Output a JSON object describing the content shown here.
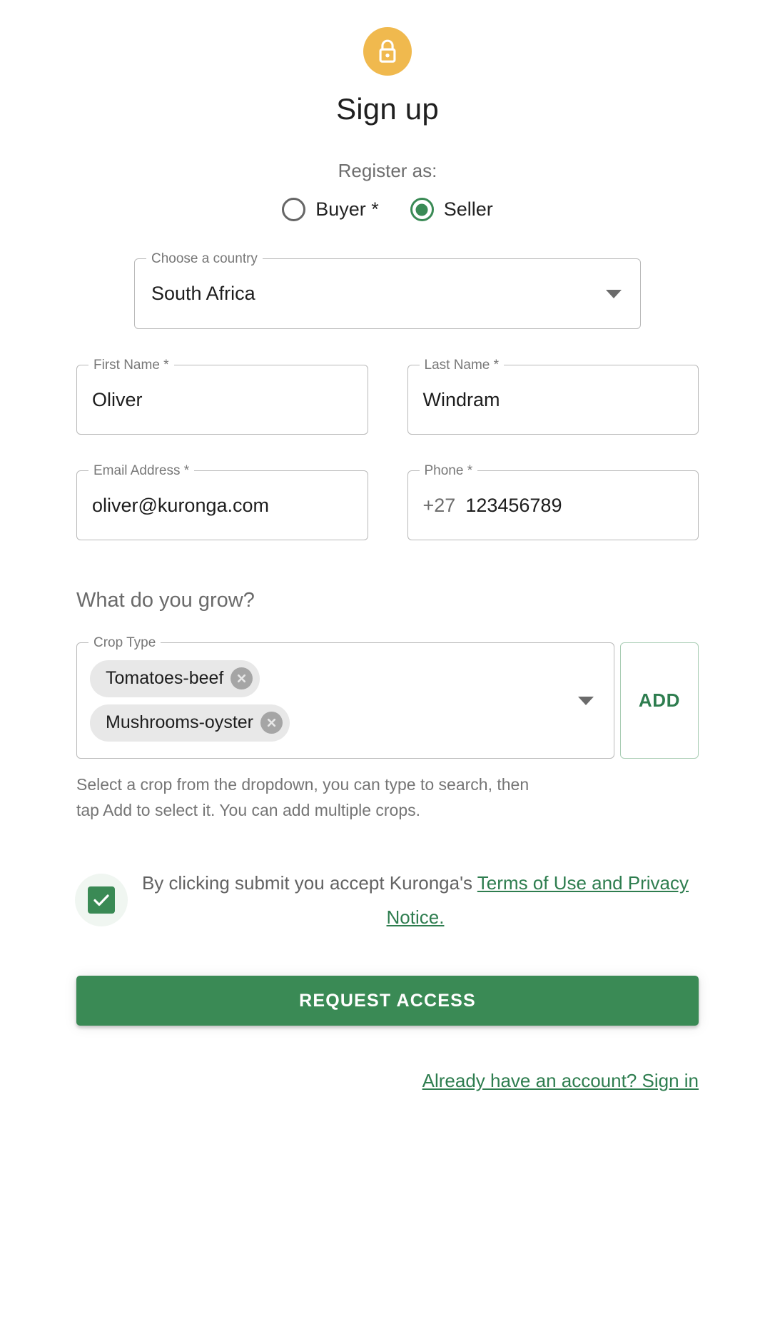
{
  "header": {
    "icon": "lock-icon",
    "title": "Sign up",
    "badge_color": "#f0b94e"
  },
  "register": {
    "label": "Register as:",
    "options": [
      {
        "label": "Buyer *",
        "selected": false
      },
      {
        "label": "Seller",
        "selected": true
      }
    ]
  },
  "country": {
    "legend": "Choose a country",
    "value": "South Africa",
    "icon": "chevron-down-icon"
  },
  "fields": {
    "first_name": {
      "legend": "First Name *",
      "value": "Oliver"
    },
    "last_name": {
      "legend": "Last Name *",
      "value": "Windram"
    },
    "email": {
      "legend": "Email Address *",
      "value": "oliver@kuronga.com"
    },
    "phone": {
      "legend": "Phone *",
      "prefix": "+27",
      "value": "123456789"
    }
  },
  "grow": {
    "question": "What do you grow?",
    "crop_legend": "Crop Type",
    "chips": [
      {
        "label": "Tomatoes-beef",
        "remove_icon": "close-circle-icon"
      },
      {
        "label": "Mushrooms-oyster",
        "remove_icon": "close-circle-icon"
      }
    ],
    "add_label": "ADD",
    "helper": "Select a crop from the dropdown, you can type to search, then tap Add to select it. You can add multiple crops."
  },
  "terms": {
    "checked": true,
    "text_before": "By clicking submit you accept Kuronga's ",
    "link_text": "Terms of Use and Privacy Notice."
  },
  "submit": {
    "label": "REQUEST ACCESS"
  },
  "signin": {
    "label": "Already have an account? Sign in"
  },
  "colors": {
    "green": "#3a8a55",
    "link_green": "#2e7d4f",
    "amber": "#f0b94e",
    "chip_bg": "#e8e8e8"
  }
}
